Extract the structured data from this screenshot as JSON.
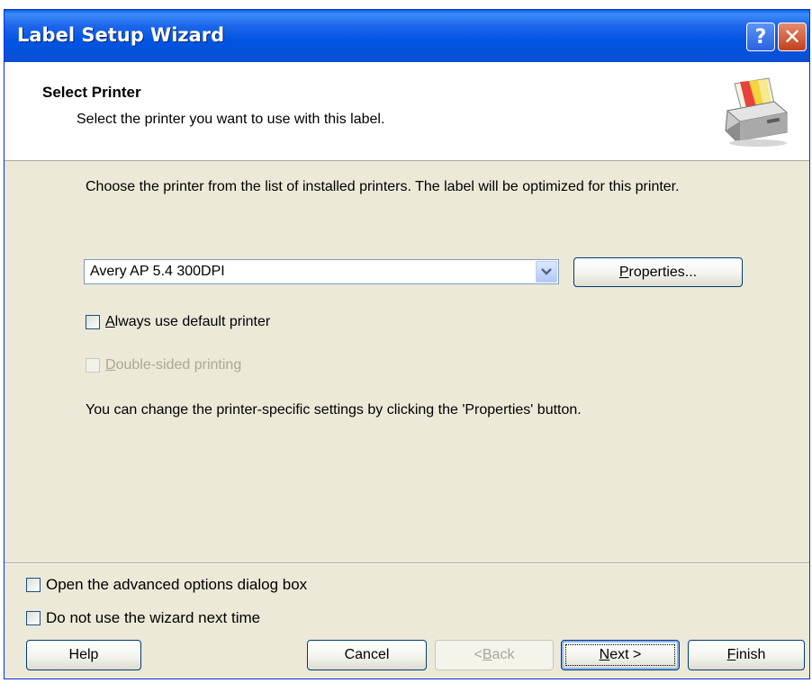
{
  "window": {
    "title": "Label Setup Wizard",
    "help_glyph": "?",
    "close_glyph": "✕"
  },
  "header": {
    "title": "Select Printer",
    "subtitle": "Select the printer you want to use with this label.",
    "icon": "printer-icon"
  },
  "main": {
    "intro": "Choose the printer from the list of installed printers. The label will be optimized for this printer.",
    "printer_select": {
      "value": "Avery AP 5.4 300DPI"
    },
    "properties_button": {
      "label_underlined": "P",
      "label_rest": "roperties..."
    },
    "always_default": {
      "checked": false,
      "label_underlined": "A",
      "label_rest": "lways use default printer"
    },
    "double_sided": {
      "checked": false,
      "enabled": false,
      "label_underlined": "D",
      "label_rest": "ouble-sided printing"
    },
    "hint": "You can change the printer-specific settings by clicking the 'Properties' button."
  },
  "footer": {
    "advanced_options": {
      "checked": false,
      "label": "Open the advanced options dialog box"
    },
    "no_wizard": {
      "checked": false,
      "label": "Do not use the wizard next time"
    },
    "buttons": {
      "help": "Help",
      "cancel": "Cancel",
      "back_prefix": "< ",
      "back_underlined": "B",
      "back_rest": "ack",
      "next_underlined": "N",
      "next_rest": "ext >",
      "finish_underlined": "F",
      "finish_rest": "inish"
    }
  },
  "colors": {
    "titlebar": "#0054e3",
    "dialog_face": "#ece9d8",
    "disabled_text": "#aca899"
  }
}
